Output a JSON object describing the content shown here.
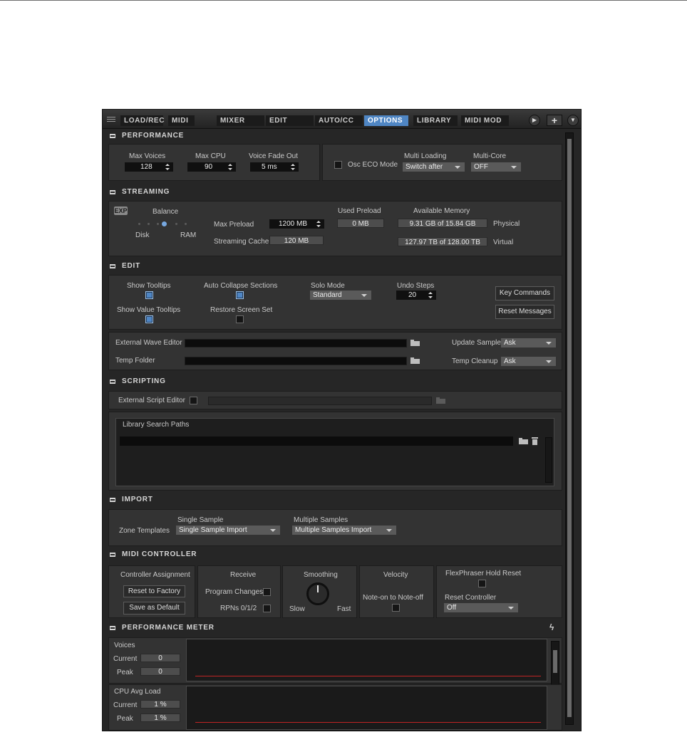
{
  "tabs": {
    "load_rec": "LOAD/REC",
    "midi": "MIDI",
    "mixer": "MIXER",
    "edit": "EDIT",
    "auto_cc": "AUTO/CC",
    "options": "OPTIONS",
    "library": "LIBRARY",
    "midi_mod": "MIDI MOD"
  },
  "tabbar": {
    "play_glyph": "▶",
    "add_glyph": "+",
    "menu_glyph": "▼"
  },
  "performance": {
    "title": "PERFORMANCE",
    "max_voices_label": "Max Voices",
    "max_voices_value": "128",
    "max_cpu_label": "Max CPU",
    "max_cpu_value": "90",
    "voice_fade_label": "Voice Fade Out",
    "voice_fade_value": "5 ms",
    "osc_eco_label": "Osc ECO Mode",
    "osc_eco_checked": false,
    "multi_loading_label": "Multi Loading",
    "multi_loading_value": "Switch after",
    "multi_core_label": "Multi-Core",
    "multi_core_value": "OFF"
  },
  "streaming": {
    "title": "STREAMING",
    "exp_badge": "EXP",
    "balance_label": "Balance",
    "balance_value": 0.5,
    "disk_label": "Disk",
    "ram_label": "RAM",
    "max_preload_label": "Max Preload",
    "max_preload_value": "1200 MB",
    "streaming_cache_label": "Streaming Cache",
    "streaming_cache_value": "120 MB",
    "used_preload_label": "Used Preload",
    "used_preload_value": "0 MB",
    "available_memory_label": "Available Memory",
    "physical_value": "9.31 GB of 15.84 GB",
    "physical_label": "Physical",
    "virtual_value": "127.97 TB of 128.00 TB",
    "virtual_label": "Virtual"
  },
  "edit": {
    "title": "EDIT",
    "show_tooltips_label": "Show Tooltips",
    "show_tooltips": true,
    "show_value_tooltips_label": "Show Value Tooltips",
    "show_value_tooltips": true,
    "auto_collapse_label": "Auto Collapse Sections",
    "auto_collapse": true,
    "restore_screen_label": "Restore Screen Set",
    "restore_screen": false,
    "solo_mode_label": "Solo Mode",
    "solo_mode_value": "Standard",
    "undo_steps_label": "Undo Steps",
    "undo_steps_value": "20",
    "key_commands_button": "Key Commands",
    "reset_messages_button": "Reset Messages",
    "external_wave_editor_label": "External Wave Editor",
    "temp_folder_label": "Temp Folder",
    "update_sample_label": "Update Sample",
    "update_sample_value": "Ask",
    "temp_cleanup_label": "Temp Cleanup",
    "temp_cleanup_value": "Ask"
  },
  "scripting": {
    "title": "SCRIPTING",
    "external_script_editor_label": "External Script Editor",
    "external_script_editor_checked": false,
    "library_search_paths_label": "Library Search Paths"
  },
  "import": {
    "title": "IMPORT",
    "zone_templates_label": "Zone Templates",
    "single_sample_label": "Single Sample",
    "single_sample_value": "Single Sample Import",
    "multiple_samples_label": "Multiple Samples",
    "multiple_samples_value": "Multiple Samples Import"
  },
  "midi_controller": {
    "title": "MIDI CONTROLLER",
    "controller_assignment_label": "Controller Assignment",
    "reset_to_factory_button": "Reset to Factory",
    "save_as_default_button": "Save as Default",
    "receive_label": "Receive",
    "program_changes_label": "Program Changes",
    "program_changes": false,
    "rpns_label": "RPNs 0/1/2",
    "rpns": false,
    "smoothing_label": "Smoothing",
    "slow_label": "Slow",
    "fast_label": "Fast",
    "smoothing_value": 0.5,
    "velocity_label": "Velocity",
    "note_on_to_note_off_label": "Note-on to Note-off",
    "note_on_to_note_off": false,
    "flexphraser_label": "FlexPhraser Hold Reset",
    "flexphraser": false,
    "reset_controller_label": "Reset Controller",
    "reset_controller_value": "Off"
  },
  "performance_meter": {
    "title": "PERFORMANCE METER",
    "voices_label": "Voices",
    "voices_current_label": "Current",
    "voices_current_value": "0",
    "voices_peak_label": "Peak",
    "voices_peak_value": "0",
    "cpu_label": "CPU Avg Load",
    "cpu_current_label": "Current",
    "cpu_current_value": "1 %",
    "cpu_peak_label": "Peak",
    "cpu_peak_value": "1 %",
    "bolt_glyph": "ϟ"
  }
}
